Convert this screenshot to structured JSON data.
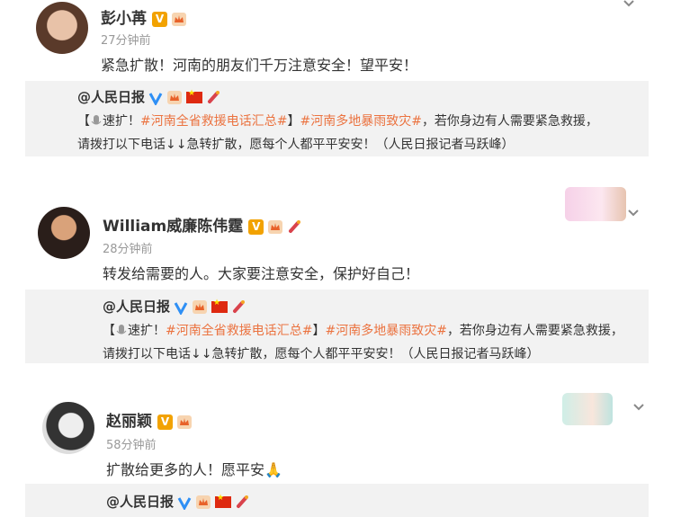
{
  "posts": [
    {
      "name": "彭小苒",
      "time": "27分钟前",
      "text": "紧急扩散！河南的朋友们千万注意安全！望平安！",
      "repost": {
        "author": "@人民日报",
        "line1_pre": "【",
        "line1_speed": "速扩！",
        "line1_topic1": "#河南全省救援电话汇总#",
        "line1_close": "】",
        "line1_topic2": "#河南多地暴雨致灾#",
        "line1_post": "，若你身边有人需要紧急救援，",
        "line2": "请拨打以下电话↓↓急转扩散，愿每个人都平平安安！（人民日报记者马跃峰）"
      }
    },
    {
      "name": "William威廉陈伟霆",
      "time": "28分钟前",
      "text": "转发给需要的人。大家要注意安全，保护好自己！",
      "repost": {
        "author": "@人民日报",
        "line1_pre": "【",
        "line1_speed": "速扩！",
        "line1_topic1": "#河南全省救援电话汇总#",
        "line1_close": "】",
        "line1_topic2": "#河南多地暴雨致灾#",
        "line1_post": "，若你身边有人需要紧急救援，",
        "line2": "请拨打以下电话↓↓急转扩散，愿每个人都平平安安！（人民日报记者马跃峰）"
      }
    },
    {
      "name": "赵丽颖",
      "time": "58分钟前",
      "text": "扩散给更多的人！愿平安🙏",
      "repost": {
        "author": "@人民日报"
      }
    }
  ],
  "icons": {
    "verified_badge": "v-badge-icon",
    "crown": "crown-icon",
    "blue_v": "blue-v-icon",
    "flag": "china-flag-icon",
    "candle": "candle-icon",
    "chevron": "chevron-down-icon",
    "mic": "microphone-icon"
  },
  "colors": {
    "topic": "#eb7340",
    "badge_gold": "#f2a201",
    "repost_bg": "#f2f2f2"
  }
}
